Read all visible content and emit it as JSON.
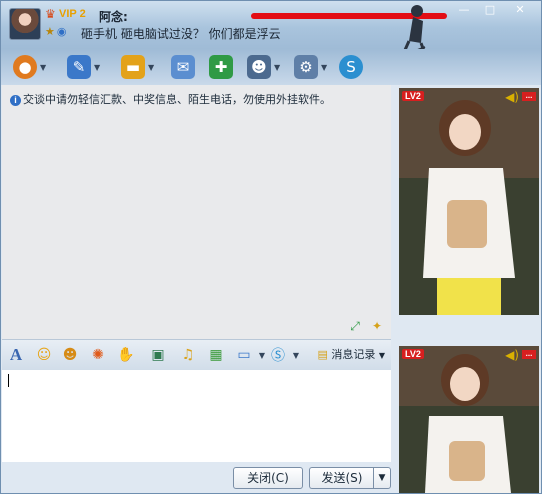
{
  "header": {
    "vip_label": "VIP 2",
    "nickname": "阿念:",
    "signature": "砸手机 砸电脑试过没？ 你们都是浮云"
  },
  "window_controls": {
    "minimize": "—",
    "maximize": "□",
    "close": "✕"
  },
  "toolbar": {
    "icons": [
      "video-call-icon",
      "voice-call-icon",
      "send-file-icon",
      "email-icon",
      "create-group-icon",
      "contact-card-icon",
      "settings-icon",
      "soso-icon"
    ]
  },
  "chat": {
    "warning": "交谈中请勿轻信汇款、中奖信息、陌生电话，勿使用外挂软件。"
  },
  "format_bar": {
    "history_label": "消息记录",
    "font_glyph": "A"
  },
  "buttons": {
    "close_label": "关闭(C)",
    "send_label": "发送(S)",
    "send_menu_arrow": "▼"
  },
  "video": {
    "level_badge": "LV2",
    "more_label": "..."
  },
  "colors": {
    "accent_blue": "#2f6fc6",
    "red_mark": "#e30d14",
    "frame_bg": "#dfe8f2"
  }
}
